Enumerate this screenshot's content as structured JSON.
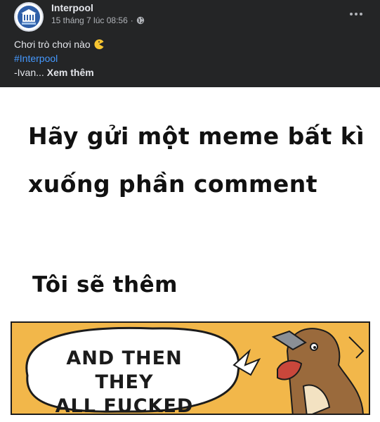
{
  "post": {
    "author": "Interpool",
    "timestamp": "15 tháng 7 lúc 08:56",
    "separator": "·",
    "privacy_icon": "globe-icon",
    "more_icon": "more-horizontal-icon"
  },
  "caption": {
    "line1": "Chơi trò chơi nào",
    "line1_emoji": "pacman-emoji",
    "hashtag": "#Interpool",
    "line3_prefix": "-Ivan...",
    "see_more": "Xem thêm"
  },
  "image": {
    "line1": "Hãy gửi một meme bất kì",
    "line2": "xuống phần comment",
    "line3": "Tôi sẽ thêm",
    "comic_line1": "AND THEN THEY",
    "comic_line2": "ALL FUCKED"
  },
  "colors": {
    "background": "#242526",
    "text_primary": "#e4e6eb",
    "text_secondary": "#b0b3b8",
    "hashtag": "#4599ff",
    "comic_bg": "#f2b74a"
  }
}
